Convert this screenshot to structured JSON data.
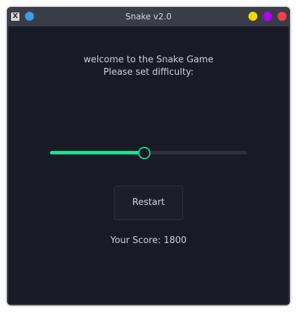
{
  "window": {
    "title": "Snake v2.0",
    "app_icon_glyph": "X",
    "app_icon": "x-window-icon",
    "controls": {
      "pin_color": "#3d9be9",
      "minimize_color": "#f6d600",
      "maximize_color": "#b100f0",
      "close_color": "#f2404a"
    }
  },
  "main": {
    "welcome_line1": "welcome to the Snake Game",
    "welcome_line2": "Please set difficulty:",
    "difficulty": {
      "value": 0.48,
      "fill_color": "#1fe08e",
      "thumb_color": "#21c98c"
    },
    "restart_label": "Restart",
    "score_text": "Your Score: 1800"
  }
}
